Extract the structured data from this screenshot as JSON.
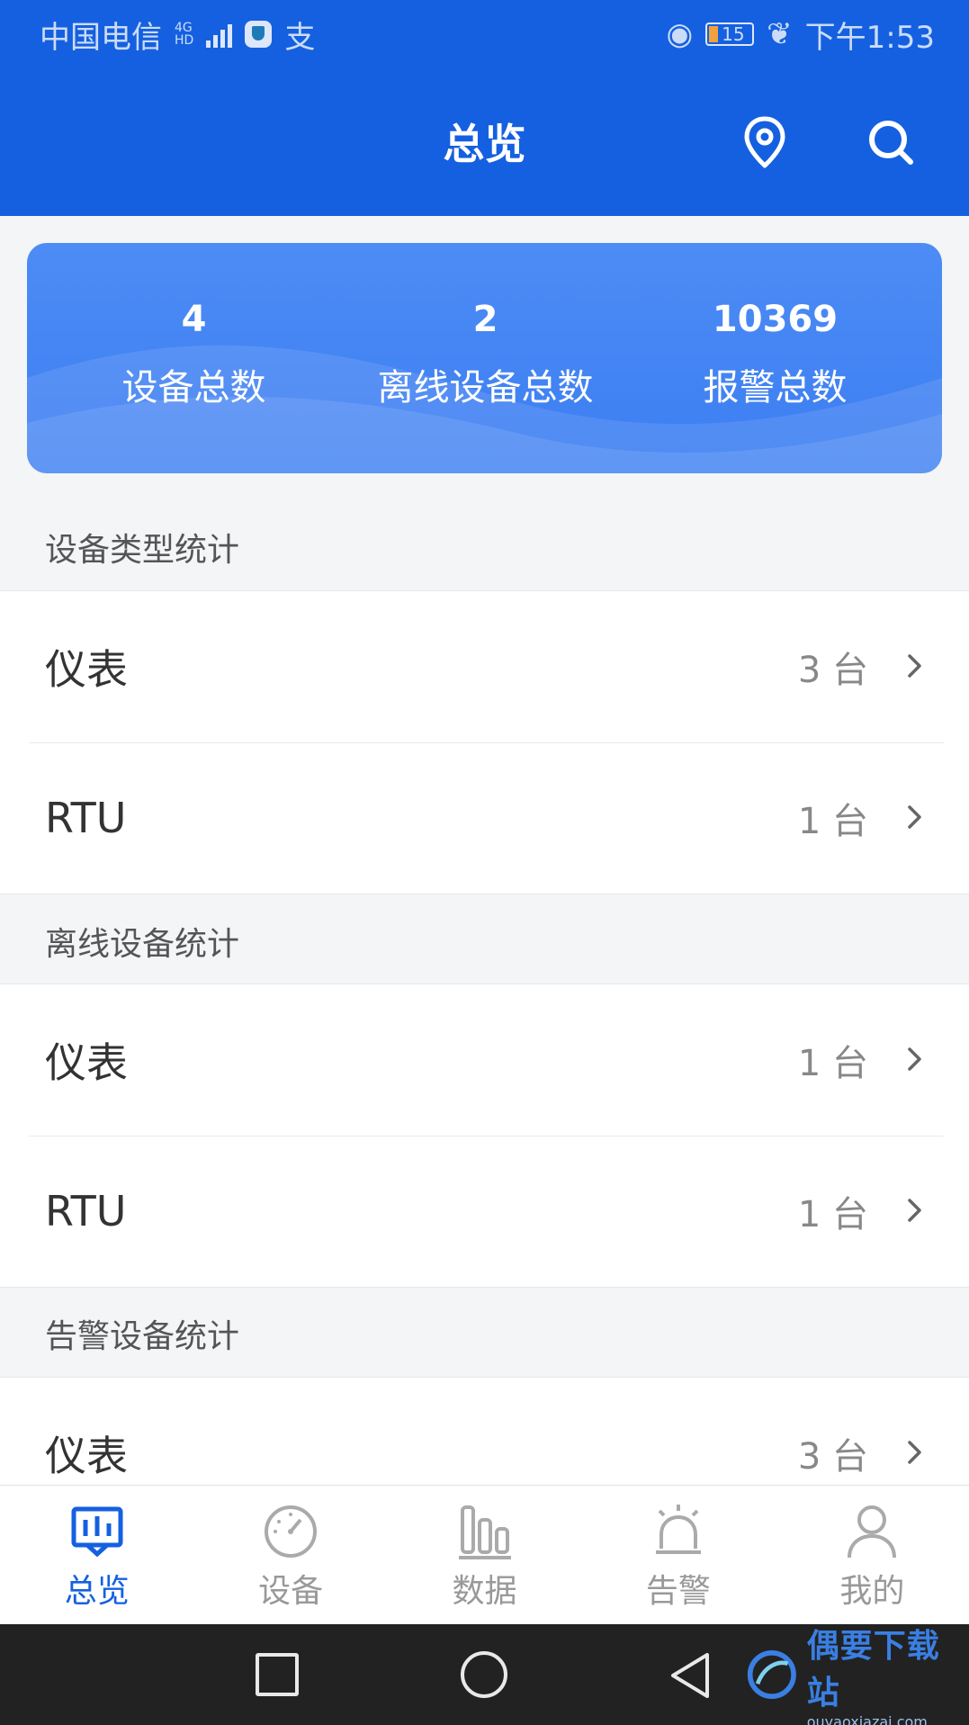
{
  "status_bar": {
    "carrier": "中国电信",
    "network_top": "4G",
    "network_bottom": "HD",
    "app_glyph": "支",
    "battery": "15",
    "time": "下午1:53"
  },
  "header": {
    "title": "总览"
  },
  "summary": [
    {
      "value": "4",
      "label": "设备总数"
    },
    {
      "value": "2",
      "label": "离线设备总数"
    },
    {
      "value": "10369",
      "label": "报警总数"
    }
  ],
  "sections": [
    {
      "title": "设备类型统计",
      "items": [
        {
          "name": "仪表",
          "count": "3 台"
        },
        {
          "name": "RTU",
          "count": "1 台"
        }
      ]
    },
    {
      "title": "离线设备统计",
      "items": [
        {
          "name": "仪表",
          "count": "1 台"
        },
        {
          "name": "RTU",
          "count": "1 台"
        }
      ]
    },
    {
      "title": "告警设备统计",
      "items": [
        {
          "name": "仪表",
          "count": "3 台"
        }
      ]
    }
  ],
  "bottom_nav": [
    {
      "label": "总览",
      "icon": "overview-icon",
      "active": true
    },
    {
      "label": "设备",
      "icon": "device-icon",
      "active": false
    },
    {
      "label": "数据",
      "icon": "data-icon",
      "active": false
    },
    {
      "label": "告警",
      "icon": "alarm-icon",
      "active": false
    },
    {
      "label": "我的",
      "icon": "profile-icon",
      "active": false
    }
  ],
  "watermark": {
    "main": "偶要下载站",
    "sub": "ouyaoxiazai.com"
  },
  "colors": {
    "primary": "#1560e0",
    "card": "#4d8cf5"
  }
}
